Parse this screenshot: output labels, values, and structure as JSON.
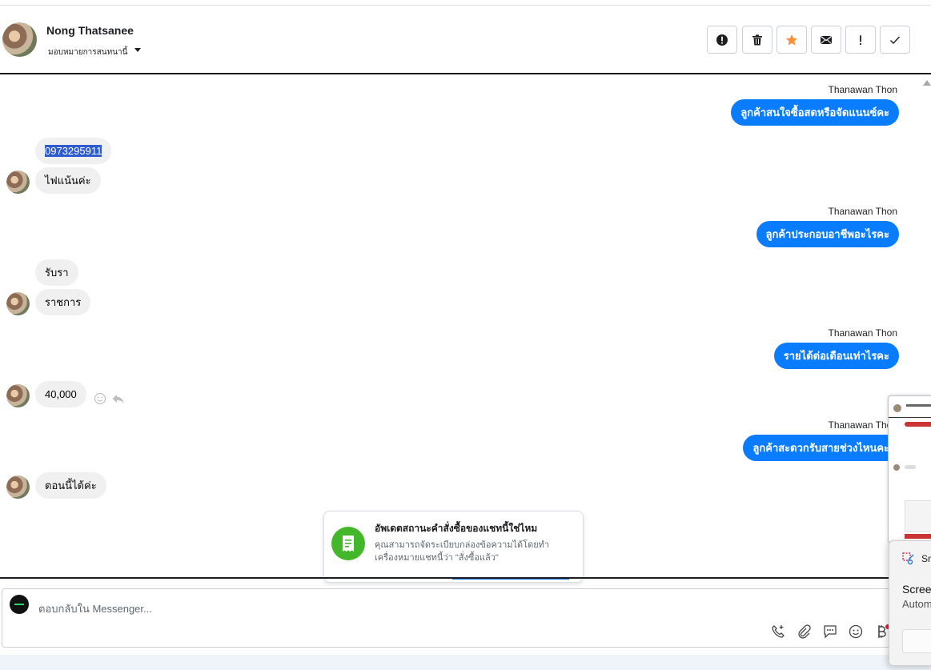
{
  "header": {
    "contact_name": "Nong Thatsanee",
    "assign_label": "มอบหมายการสนทนานี้",
    "buttons": [
      {
        "name": "spam-button",
        "icon": "exclamation-circle-icon"
      },
      {
        "name": "delete-button",
        "icon": "trash-icon"
      },
      {
        "name": "star-button",
        "icon": "star-icon"
      },
      {
        "name": "mark-unread-button",
        "icon": "envelope-icon"
      },
      {
        "name": "follow-up-button",
        "icon": "exclamation-icon"
      },
      {
        "name": "done-button",
        "icon": "checkmark-icon"
      }
    ]
  },
  "messages": {
    "agent_name": "Thanawan Thon",
    "out1": "ลูกค้าสนใจซื้อสดหรือจัดแนนซ์คะ",
    "in1a": "0973295911",
    "in1b": "ไฟแน้นค่ะ",
    "out2": "ลูกค้าประกอบอาชีพอะไรคะ",
    "in2a": "รับรา",
    "in2b": "ราชการ",
    "out3": "รายได้ต่อเดือนเท่าไรคะ",
    "in3": "40,000",
    "out4": "ลูกค้าสะดวกรับสายช่วงไหนคะ",
    "in4": "ตอนนี้ได้ค่ะ"
  },
  "popup": {
    "title": "อัพเดตสถานะคำสั่งซื้อของแชทนี้ใช่ไหม",
    "description": "คุณสามารถจัดระเบียบกล่องข้อความได้โดยทำเครื่องหมายแชทนี้ว่า \"สั่งซื้อแล้ว\""
  },
  "composer": {
    "placeholder": "ตอบกลับใน Messenger..."
  },
  "toast": {
    "app": "Sn",
    "title": "Screen",
    "subtitle": "Autom"
  },
  "colors": {
    "outgoing_bubble": "#0a7cff",
    "incoming_bubble": "#f0f0f0",
    "star": "#f7923b",
    "popup_icon": "#42b72a"
  }
}
